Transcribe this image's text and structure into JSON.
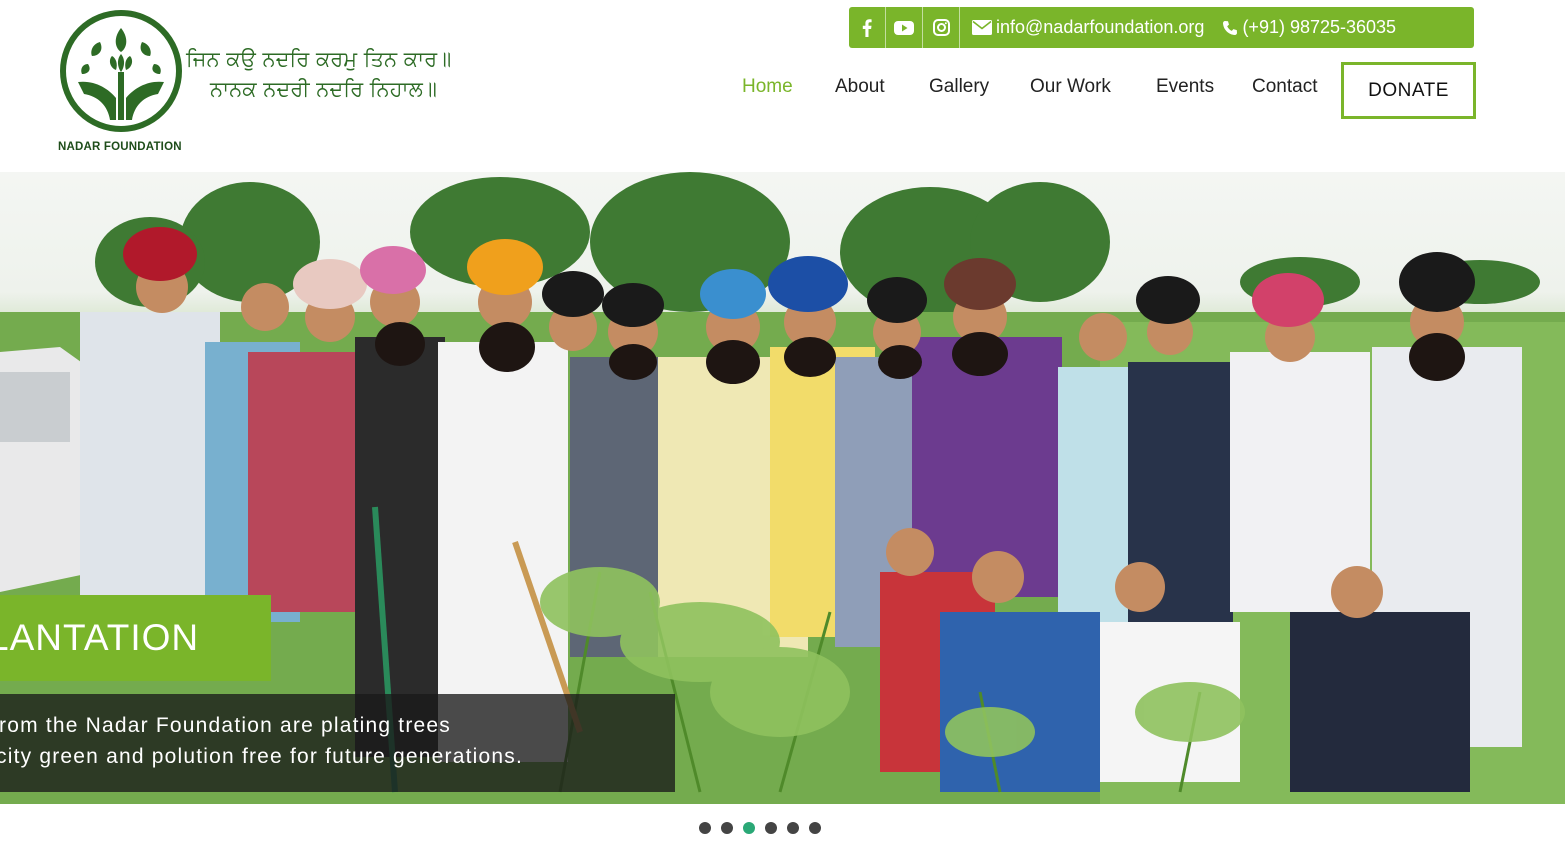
{
  "header": {
    "logo_name": "NADAR FOUNDATION",
    "motto_line1": "ਜਿਨ ਕਉ ਨਦਰਿ ਕਰਮੁ ਤਿਨ ਕਾਰ॥",
    "motto_line2": "ਨਾਨਕ ਨਦਰੀ ਨਦਰਿ ਨਿਹਾਲ॥"
  },
  "contact_bar": {
    "social_icons": [
      "facebook-icon",
      "youtube-icon",
      "instagram-icon"
    ],
    "email": "info@nadarfoundation.org",
    "phone": "(+91) 98725-36035"
  },
  "nav": {
    "items": [
      {
        "label": "Home",
        "active": true
      },
      {
        "label": "About"
      },
      {
        "label": "Gallery"
      },
      {
        "label": "Our Work"
      },
      {
        "label": "Events"
      },
      {
        "label": "Contact"
      }
    ],
    "donate_label": "DONATE"
  },
  "slider": {
    "title": "LANTATION",
    "caption_line1": "from the Nadar Foundation are plating trees",
    "caption_line2": "city green and polution free for future generations.",
    "slide_count": 6,
    "active_slide": 3
  },
  "colors": {
    "accent": "#7ab52a",
    "logo_green": "#2d6b25",
    "active_dot": "#2aa876"
  }
}
